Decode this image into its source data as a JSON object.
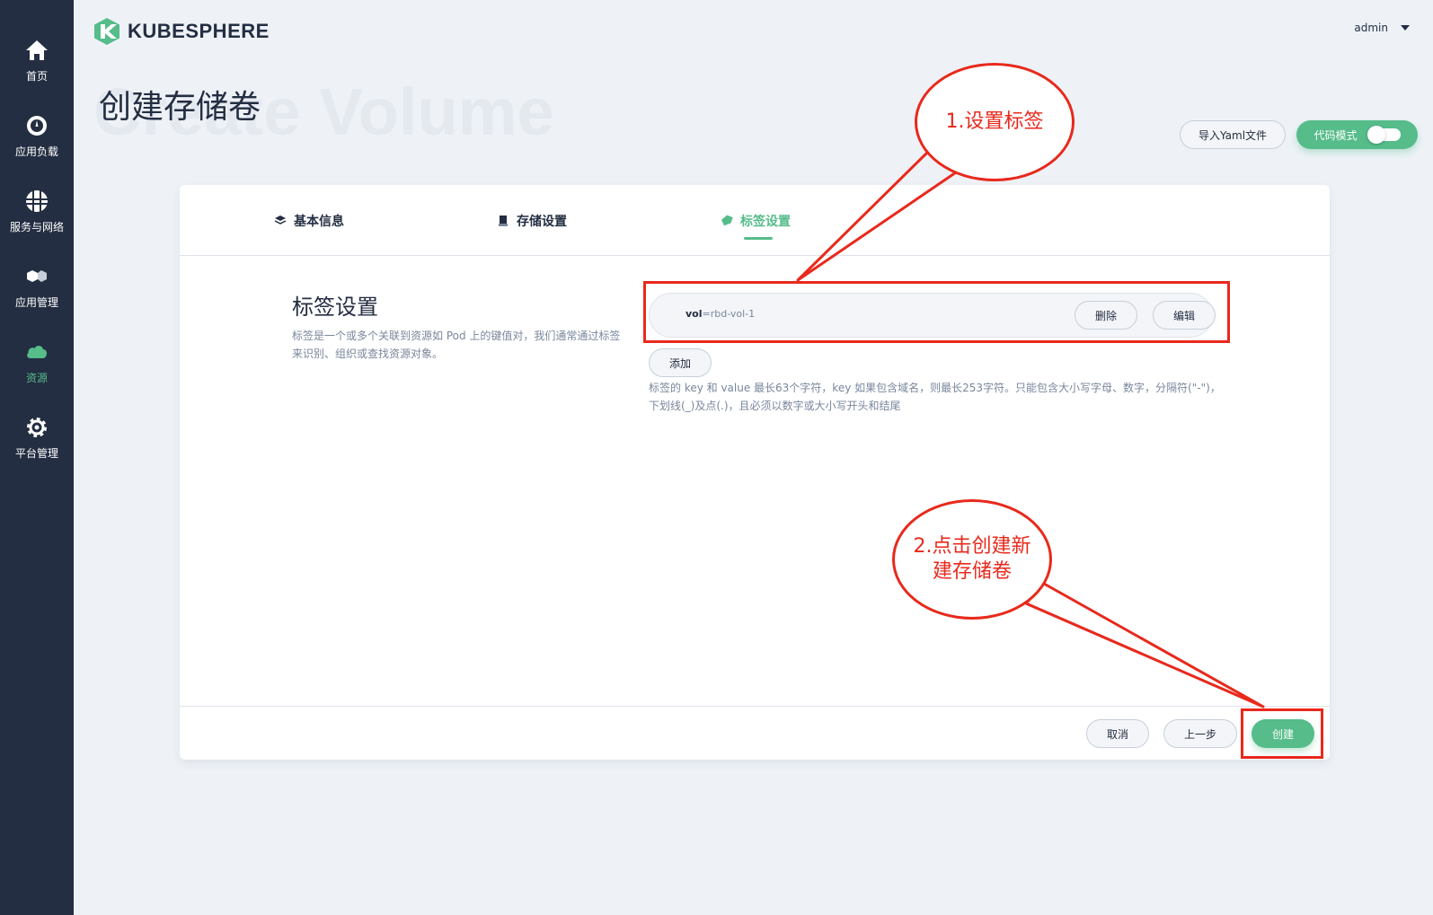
{
  "app": {
    "logo_text": "KUBESPHERE",
    "user": "admin",
    "accent_color": "#55bc8a",
    "sidebar_color": "#242e42",
    "annotation_color": "#e8291c"
  },
  "sidebar": {
    "items": [
      {
        "label": "首页",
        "icon": "home-icon"
      },
      {
        "label": "应用负载",
        "icon": "dashboard-icon"
      },
      {
        "label": "服务与网络",
        "icon": "network-icon"
      },
      {
        "label": "应用管理",
        "icon": "hexagon-icon"
      },
      {
        "label": "资源",
        "icon": "cloud-icon",
        "active": true
      },
      {
        "label": "平台管理",
        "icon": "gear-icon"
      }
    ]
  },
  "page": {
    "title": "创建存储卷",
    "bg_title": "Create Volume"
  },
  "header_actions": {
    "import_yaml": "导入Yaml文件",
    "code_mode": "代码模式"
  },
  "wizard": {
    "tabs": [
      {
        "label": "基本信息",
        "icon": "layers-icon"
      },
      {
        "label": "存储设置",
        "icon": "storage-icon"
      },
      {
        "label": "标签设置",
        "icon": "tag-icon",
        "active": true
      }
    ]
  },
  "labels_section": {
    "title": "标签设置",
    "description": "标签是一个或多个关联到资源如 Pod 上的键值对，我们通常通过标签来识别、组织或查找资源对象。",
    "label_key": "vol",
    "label_sep": "=",
    "label_value": "rbd-vol-1",
    "delete_button": "删除",
    "edit_button": "编辑",
    "add_button": "添加",
    "hint": "标签的 key 和 value 最长63个字符，key 如果包含域名，则最长253字符。只能包含大小写字母、数字，分隔符(\"-\")，下划线(_)及点(.)，且必须以数字或大小写开头和结尾"
  },
  "footer": {
    "cancel": "取消",
    "previous": "上一步",
    "create": "创建"
  },
  "annotations": {
    "step1": "1.设置标签",
    "step2": "2.点击创建新\n建存储卷"
  }
}
